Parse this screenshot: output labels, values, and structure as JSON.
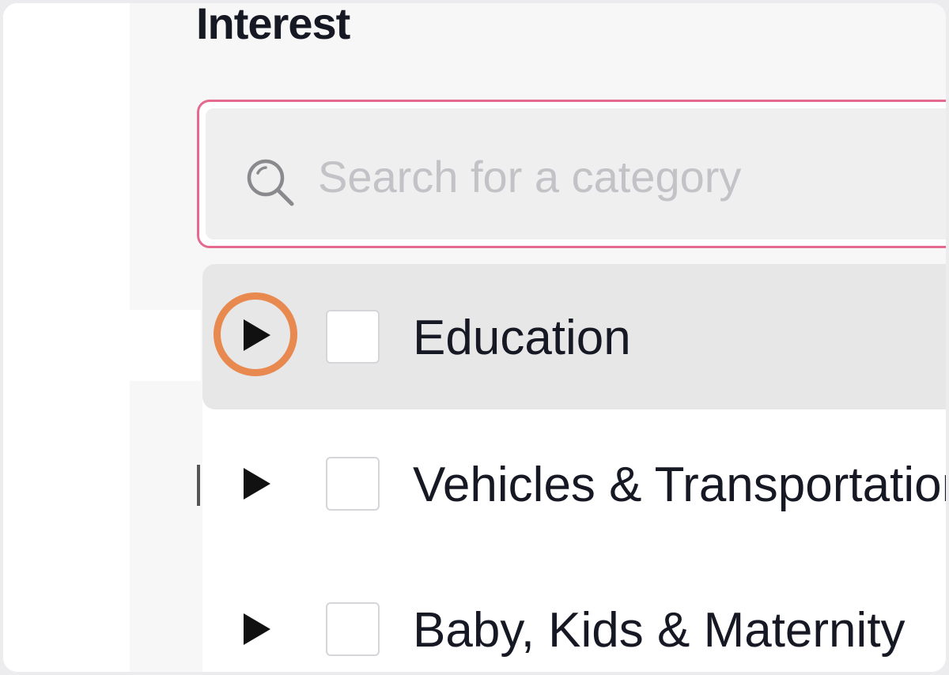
{
  "section": {
    "title": "Interest"
  },
  "search": {
    "placeholder": "Search for a category",
    "value": ""
  },
  "categories": [
    {
      "label": "Education",
      "expanded": false,
      "checked": false,
      "highlighted": true
    },
    {
      "label": "Vehicles & Transportation",
      "expanded": false,
      "checked": false,
      "highlighted": false
    },
    {
      "label": "Baby, Kids & Maternity",
      "expanded": false,
      "checked": false,
      "highlighted": false
    }
  ],
  "colors": {
    "search_border": "#e46a8f",
    "focus_ring": "#e8894f",
    "highlight_row": "#e7e7e7",
    "text": "#161823",
    "placeholder": "#c2c2c7"
  },
  "icons": {
    "search": "search-icon",
    "expand": "caret-right-icon"
  }
}
